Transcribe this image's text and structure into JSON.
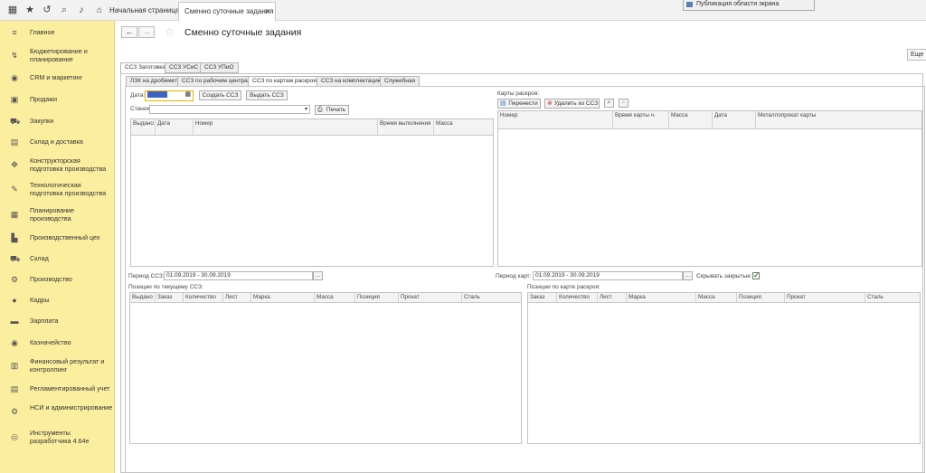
{
  "topbar": {
    "home_tab": "Начальная страница",
    "active_tab": "Сменно суточные задания",
    "popup": "Публикация области экрана"
  },
  "sidebar": {
    "items": [
      {
        "label": "Главное",
        "icon": "menu-icon"
      },
      {
        "label": "Бюджетирование и планирование",
        "icon": "budget-icon"
      },
      {
        "label": "CRM и маркетинг",
        "icon": "crm-icon"
      },
      {
        "label": "Продажи",
        "icon": "sales-icon"
      },
      {
        "label": "Закупки",
        "icon": "cart-icon"
      },
      {
        "label": "Склад и доставка",
        "icon": "warehouse-icon"
      },
      {
        "label": "Конструкторская подготовка производства",
        "icon": "design-icon"
      },
      {
        "label": "Технологическая подготовка производства",
        "icon": "tech-icon"
      },
      {
        "label": "Планирование производства",
        "icon": "planning-icon"
      },
      {
        "label": "Производственный цех",
        "icon": "factory-icon"
      },
      {
        "label": "Склад",
        "icon": "stock-icon"
      },
      {
        "label": "Производство",
        "icon": "production-icon"
      },
      {
        "label": "Кадры",
        "icon": "staff-icon"
      },
      {
        "label": "Зарплата",
        "icon": "salary-icon"
      },
      {
        "label": "Казначейство",
        "icon": "treasury-icon"
      },
      {
        "label": "Финансовый результат и контроллинг",
        "icon": "finance-icon"
      },
      {
        "label": "Регламентированный учет",
        "icon": "accounting-icon"
      },
      {
        "label": "НСИ и администрирование",
        "icon": "gear-icon"
      },
      {
        "label": "Инструменты разработчика 4.64е",
        "icon": "dev-tools-icon"
      }
    ]
  },
  "page": {
    "title": "Сменно суточные задания",
    "more_label": "Еще ▾"
  },
  "tabs_level1": [
    "ССЗ Заготовка",
    "ССЗ УСиС",
    "ССЗ УПиО"
  ],
  "tabs_level2": [
    "ЛЗК на дробемет",
    "ССЗ по рабочим центрам",
    "ССЗ по картам раскроя",
    "ССЗ на комплектацию",
    "Служебная"
  ],
  "left_panel": {
    "date_label": "Дата:",
    "create_button": "Создать ССЗ",
    "issue_button": "Выдать ССЗ",
    "machine_label": "Станок:",
    "print_button": "Печать",
    "columns": [
      "Выдано",
      "Дата",
      "Номер",
      "Время выполнения",
      "Масса"
    ],
    "period_label": "Период ССЗ:",
    "period_value": "01.09.2019 - 30.09.2019",
    "positions_label": "Позиции по текущему ССЗ:",
    "positions_columns": [
      "Выдано",
      "Заказ",
      "Количество",
      "Лист",
      "Марка",
      "Масса",
      "Позиция",
      "Прокат",
      "Сталь"
    ]
  },
  "right_panel": {
    "title": "Карты раскроя:",
    "move_button": "Перенести",
    "delete_button": "Удалить из ССЗ",
    "columns": [
      "Номер",
      "Время карты ч.",
      "Масса",
      "Дата",
      "Металлопрокат карты"
    ],
    "period_label": "Период карт:",
    "period_value": "01.09.2019 - 30.09.2019",
    "hide_closed_label": "Скрывать закрытые:",
    "positions_label": "Позиции по карте раскроя:",
    "positions_columns": [
      "Заказ",
      "Количество",
      "Лист",
      "Марка",
      "Масса",
      "Позиция",
      "Прокат",
      "Сталь"
    ]
  }
}
